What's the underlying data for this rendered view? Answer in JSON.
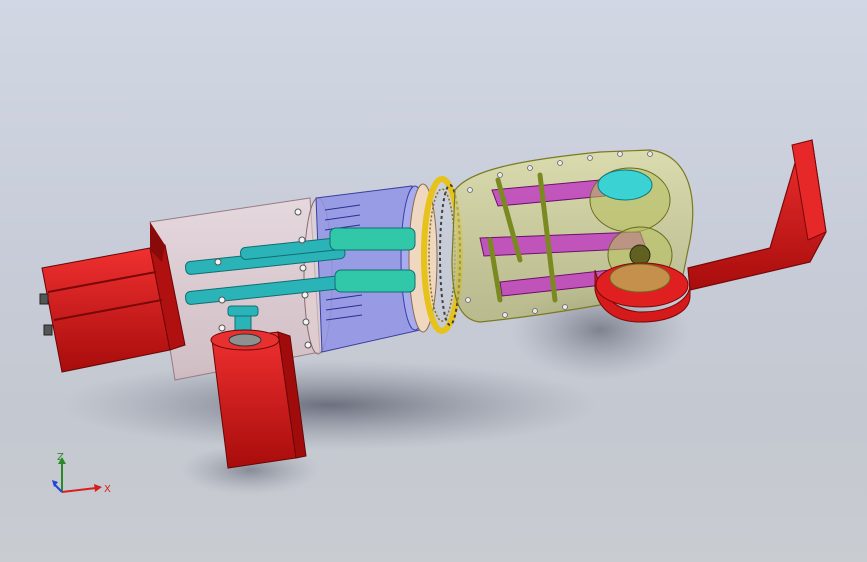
{
  "viewport": {
    "background_top": "#d2d7e4",
    "background_bottom": "#c9ccd1"
  },
  "model": {
    "parts": [
      {
        "name": "base-motor",
        "color": "#d41a1a"
      },
      {
        "name": "vertical-motor",
        "color": "#d41a1a"
      },
      {
        "name": "transparent-housing",
        "color": "#e8cfd2"
      },
      {
        "name": "shafts",
        "color": "#2bb4b8"
      },
      {
        "name": "bearing-housing",
        "color": "#8f93e6"
      },
      {
        "name": "ring-gear",
        "color": "#e6c21a"
      },
      {
        "name": "gear-case",
        "color": "#c4c86a"
      },
      {
        "name": "linkage-arms",
        "color": "#c040c0"
      },
      {
        "name": "output-pulley",
        "color": "#3ad2d2"
      },
      {
        "name": "end-effector-bracket",
        "color": "#e01e1e"
      }
    ]
  },
  "triad": {
    "x_label": "X",
    "z_label": "Z",
    "x_color": "#d81e1e",
    "z_color": "#2a8a2a",
    "y_color": "#2244d8"
  }
}
